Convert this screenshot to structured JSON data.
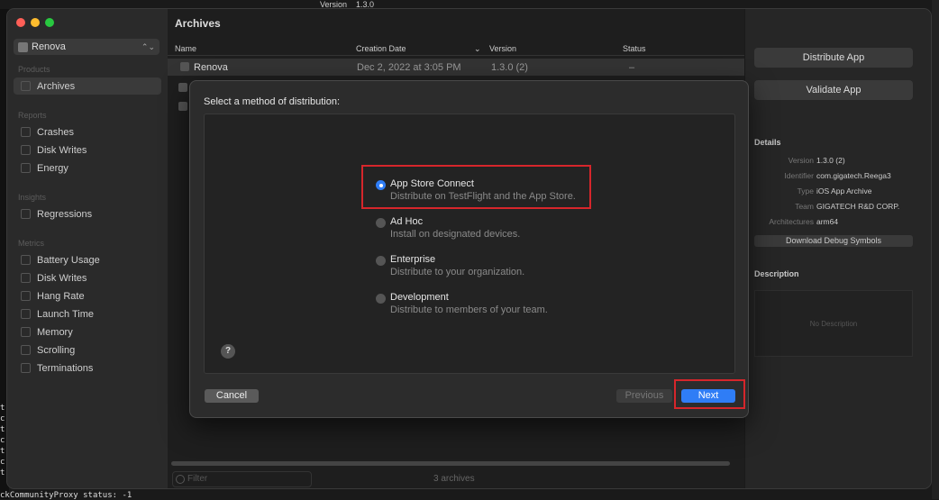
{
  "topbar": {
    "left": "Version",
    "right": "1.3.0"
  },
  "terminal": {
    "bottom_line": "ckCommunityProxy status: -1",
    "strip_chars": [
      "t",
      "c",
      "t",
      "c",
      "t",
      "c",
      "t"
    ]
  },
  "colors": {
    "traffic_red": "#ff5f57",
    "traffic_yellow": "#febc2e",
    "traffic_green": "#28c840",
    "accent": "#2f7df6",
    "highlight": "#d6262b"
  },
  "sidebar": {
    "app_name": "Renova",
    "sections": [
      {
        "label": "Products",
        "items": [
          {
            "label": "Archives",
            "icon": "archive-icon",
            "active": true
          }
        ]
      },
      {
        "label": "Reports",
        "items": [
          {
            "label": "Crashes",
            "icon": "crash-icon"
          },
          {
            "label": "Disk Writes",
            "icon": "disk-icon"
          },
          {
            "label": "Energy",
            "icon": "energy-icon"
          }
        ]
      },
      {
        "label": "Insights",
        "items": [
          {
            "label": "Regressions",
            "icon": "chart-icon"
          }
        ]
      },
      {
        "label": "Metrics",
        "items": [
          {
            "label": "Battery Usage",
            "icon": "battery-icon"
          },
          {
            "label": "Disk Writes",
            "icon": "disk-icon"
          },
          {
            "label": "Hang Rate",
            "icon": "hang-icon"
          },
          {
            "label": "Launch Time",
            "icon": "launch-icon"
          },
          {
            "label": "Memory",
            "icon": "memory-icon"
          },
          {
            "label": "Scrolling",
            "icon": "scroll-icon"
          },
          {
            "label": "Terminations",
            "icon": "termination-icon"
          }
        ]
      }
    ]
  },
  "main": {
    "title": "Archives",
    "columns": [
      "Name",
      "Creation Date",
      "Version",
      "Status"
    ],
    "rows": [
      {
        "name": "Renova",
        "date": "Dec 2, 2022 at 3:05 PM",
        "version": "1.3.0 (2)",
        "status": "–"
      }
    ],
    "filter_placeholder": "Filter",
    "count": "3 archives"
  },
  "inspector": {
    "distribute": "Distribute App",
    "validate": "Validate App",
    "details_heading": "Details",
    "details": [
      {
        "k": "Version",
        "v": "1.3.0 (2)"
      },
      {
        "k": "Identifier",
        "v": "com.gigatech.Reega3"
      },
      {
        "k": "Type",
        "v": "iOS App Archive"
      },
      {
        "k": "Team",
        "v": "GIGATECH R&D CORP."
      },
      {
        "k": "Architectures",
        "v": "arm64"
      }
    ],
    "download": "Download Debug Symbols",
    "description_heading": "Description",
    "no_description": "No Description"
  },
  "dialog": {
    "title": "Select a method of distribution:",
    "options": [
      {
        "title": "App Store Connect",
        "desc": "Distribute on TestFlight and the App Store.",
        "selected": true
      },
      {
        "title": "Ad Hoc",
        "desc": "Install on designated devices.",
        "selected": false
      },
      {
        "title": "Enterprise",
        "desc": "Distribute to your organization.",
        "selected": false
      },
      {
        "title": "Development",
        "desc": "Distribute to members of your team.",
        "selected": false
      }
    ],
    "help": "?",
    "cancel": "Cancel",
    "previous": "Previous",
    "next": "Next"
  }
}
